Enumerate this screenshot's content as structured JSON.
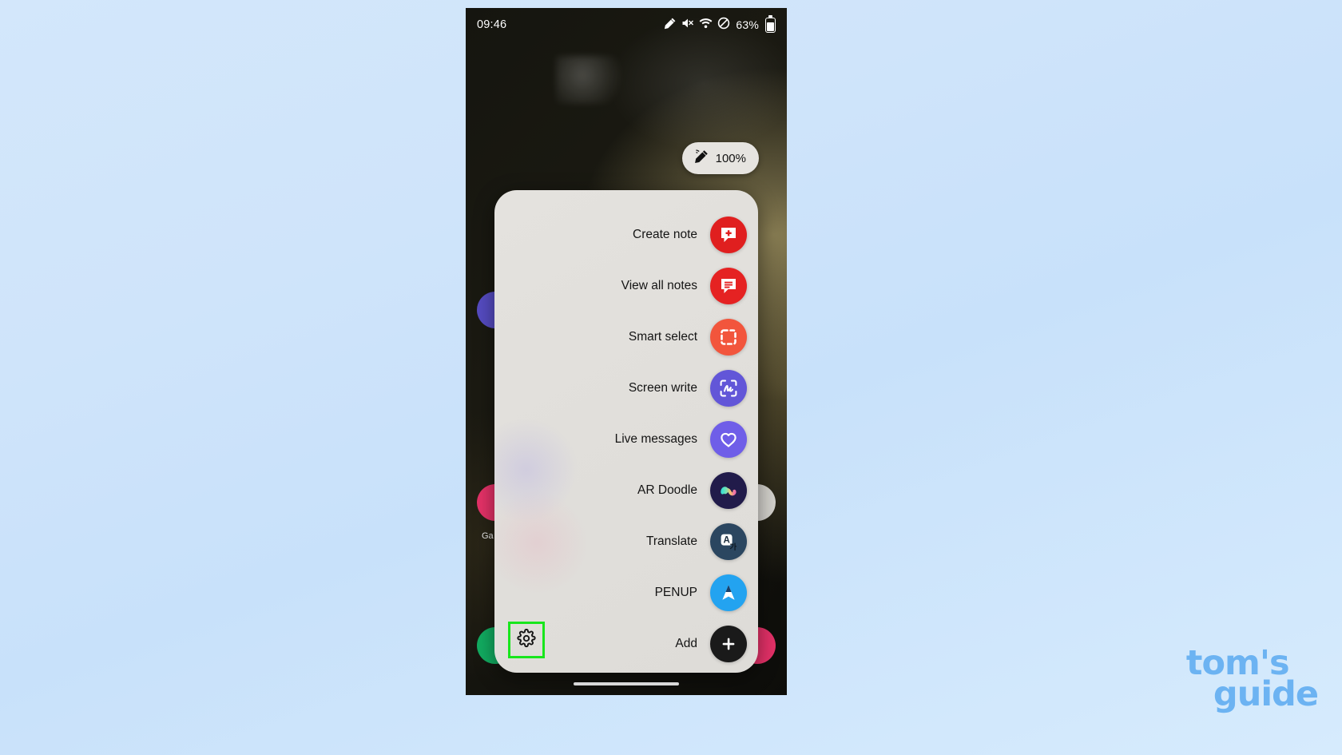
{
  "statusbar": {
    "time": "09:46",
    "battery_percent": "63%",
    "icons": [
      "spen-icon",
      "mute-icon",
      "wifi-icon",
      "dnd-icon",
      "battery-icon"
    ]
  },
  "spen_pill": {
    "icon": "spen-pen-icon",
    "label": "100%"
  },
  "air_command": {
    "items": [
      {
        "label": "Create note",
        "icon": "create-note-icon",
        "color": "#e01f1f"
      },
      {
        "label": "View all notes",
        "icon": "view-all-notes-icon",
        "color": "#e52222"
      },
      {
        "label": "Smart select",
        "icon": "smart-select-icon",
        "color": "#f2553c"
      },
      {
        "label": "Screen write",
        "icon": "screen-write-icon",
        "color": "#6256d8"
      },
      {
        "label": "Live messages",
        "icon": "live-messages-icon",
        "color": "#6f5ee8"
      },
      {
        "label": "AR Doodle",
        "icon": "ar-doodle-icon",
        "color": "#211b4a"
      },
      {
        "label": "Translate",
        "icon": "translate-icon",
        "color": "#2b4660"
      },
      {
        "label": "PENUP",
        "icon": "penup-icon",
        "color": "#23a3f0"
      },
      {
        "label": "Add",
        "icon": "add-icon",
        "color": "#1a1a1a"
      }
    ],
    "settings_label": "settings-gear",
    "highlight_color": "#18e61c"
  },
  "home_screen": {
    "partial_app_label": "Ga"
  },
  "watermark": {
    "line1": "tom's",
    "line2": "guide",
    "color": "#6cb3f2"
  }
}
